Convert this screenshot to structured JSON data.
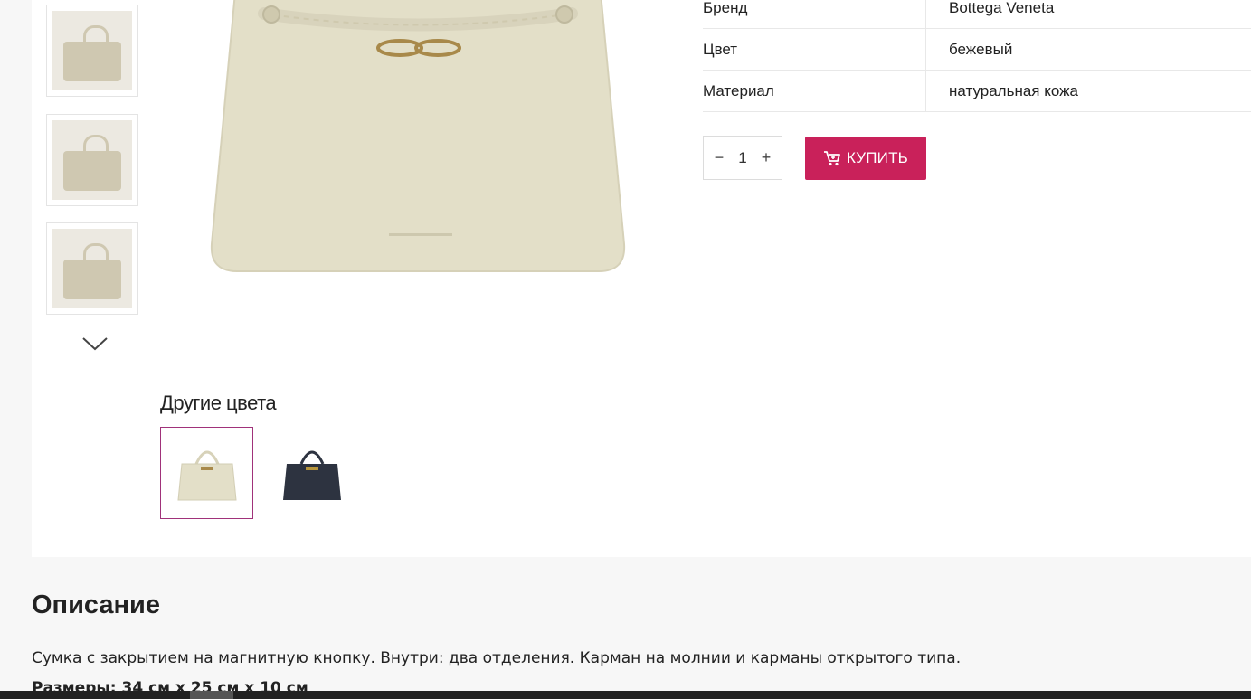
{
  "specs": [
    {
      "key": "Бренд",
      "value": "Bottega Veneta"
    },
    {
      "key": "Цвет",
      "value": "бежевый"
    },
    {
      "key": "Материал",
      "value": "натуральная кожа"
    }
  ],
  "quantity": {
    "minus": "−",
    "value": "1",
    "plus": "+"
  },
  "buy_button": {
    "label": "КУПИТЬ",
    "icon": "cart-icon",
    "color": "#c9215a"
  },
  "other_colors": {
    "title": "Другие цвета"
  },
  "description": {
    "title": "Описание",
    "text": "Сумка с закрытием на магнитную кнопку. Внутри: два отделения. Карман на молнии и карманы открытого типа.",
    "sizes": "Размеры: 34 см х 25 см х 10 см"
  },
  "colors": {
    "product_beige": "#e3dfc8",
    "product_dark": "#2d3340",
    "accent": "#c9215a",
    "active_swatch_border": "#a0327a"
  }
}
